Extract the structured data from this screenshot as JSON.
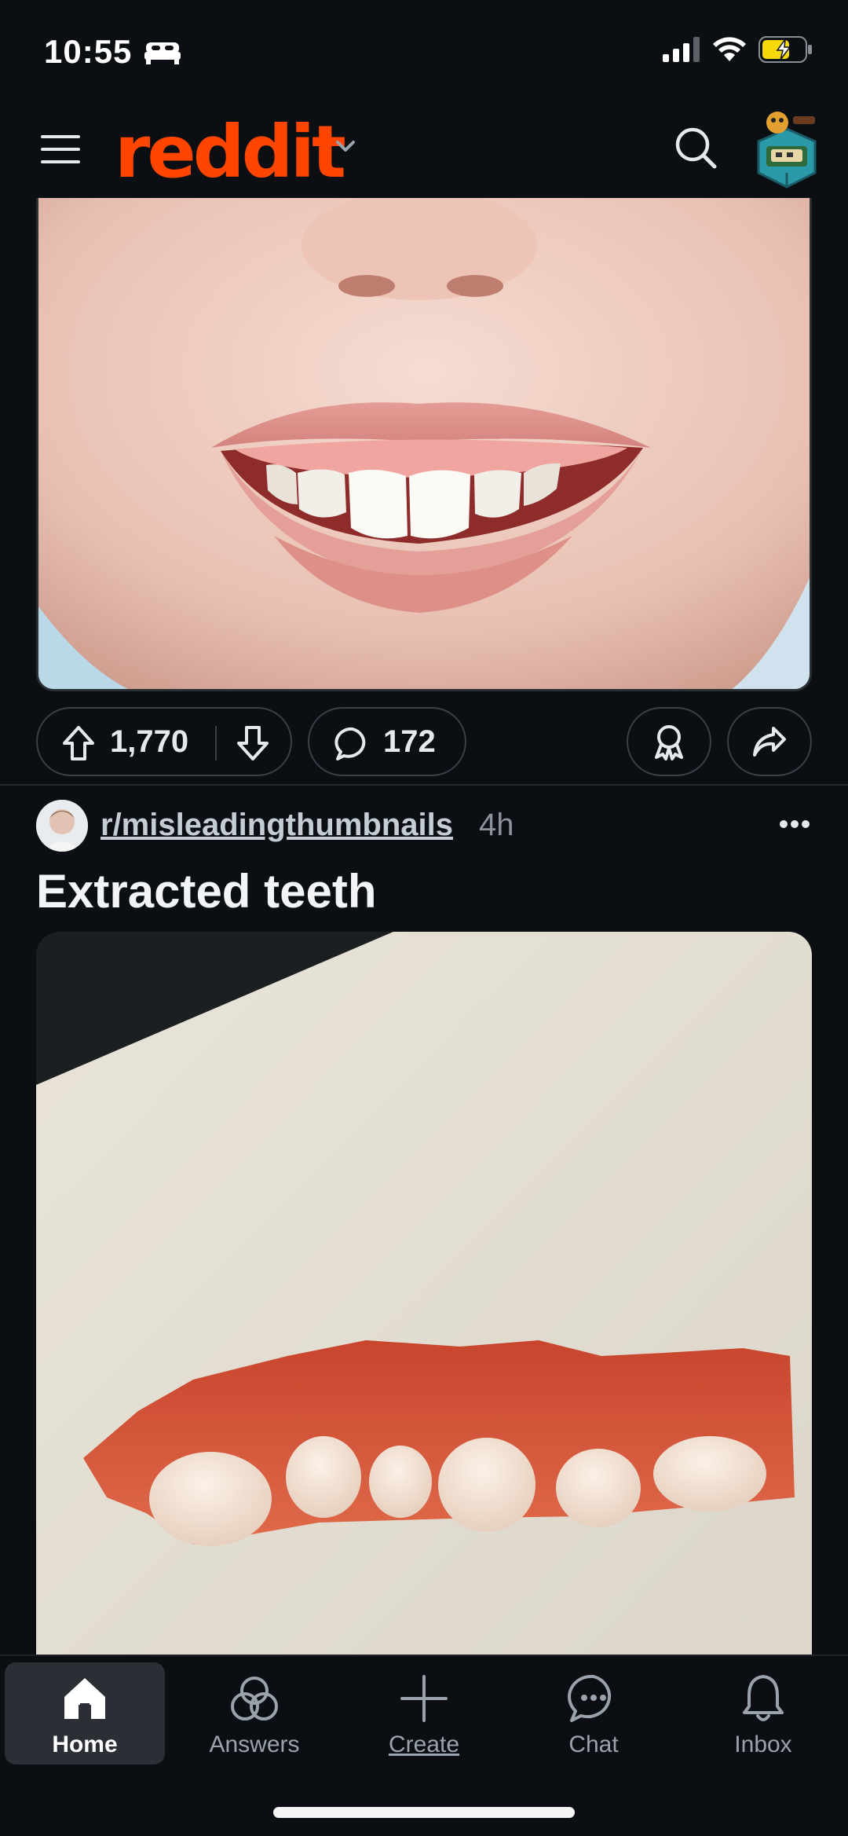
{
  "status_bar": {
    "time": "10:55",
    "mode_icon": "bed-icon",
    "signal_icon": "cellular-signal-icon",
    "wifi_icon": "wifi-icon",
    "battery_icon": "battery-charging-icon"
  },
  "header": {
    "logo_text": "reddit",
    "brand_color": "#ff4500",
    "menu_icon": "menu-icon",
    "search_icon": "search-icon",
    "avatar_icon": "user-avatar-icon"
  },
  "top_post": {
    "image_description_icon": "smile-image",
    "upvote_icon": "upvote-icon",
    "score": "1,770",
    "downvote_icon": "downvote-icon",
    "comment_icon": "comment-icon",
    "comments": "172",
    "award_icon": "award-icon",
    "share_icon": "share-icon"
  },
  "post": {
    "subreddit": "r/misleadingthumbnails",
    "age": "4h",
    "more_icon": "more-horizontal-icon",
    "title": "Extracted teeth"
  },
  "bottom_nav": {
    "items": [
      {
        "label": "Home",
        "icon": "home-icon",
        "active": true
      },
      {
        "label": "Answers",
        "icon": "answers-icon",
        "active": false
      },
      {
        "label": "Create",
        "icon": "plus-icon",
        "active": false
      },
      {
        "label": "Chat",
        "icon": "chat-icon",
        "active": false
      },
      {
        "label": "Inbox",
        "icon": "bell-icon",
        "active": false
      }
    ]
  }
}
